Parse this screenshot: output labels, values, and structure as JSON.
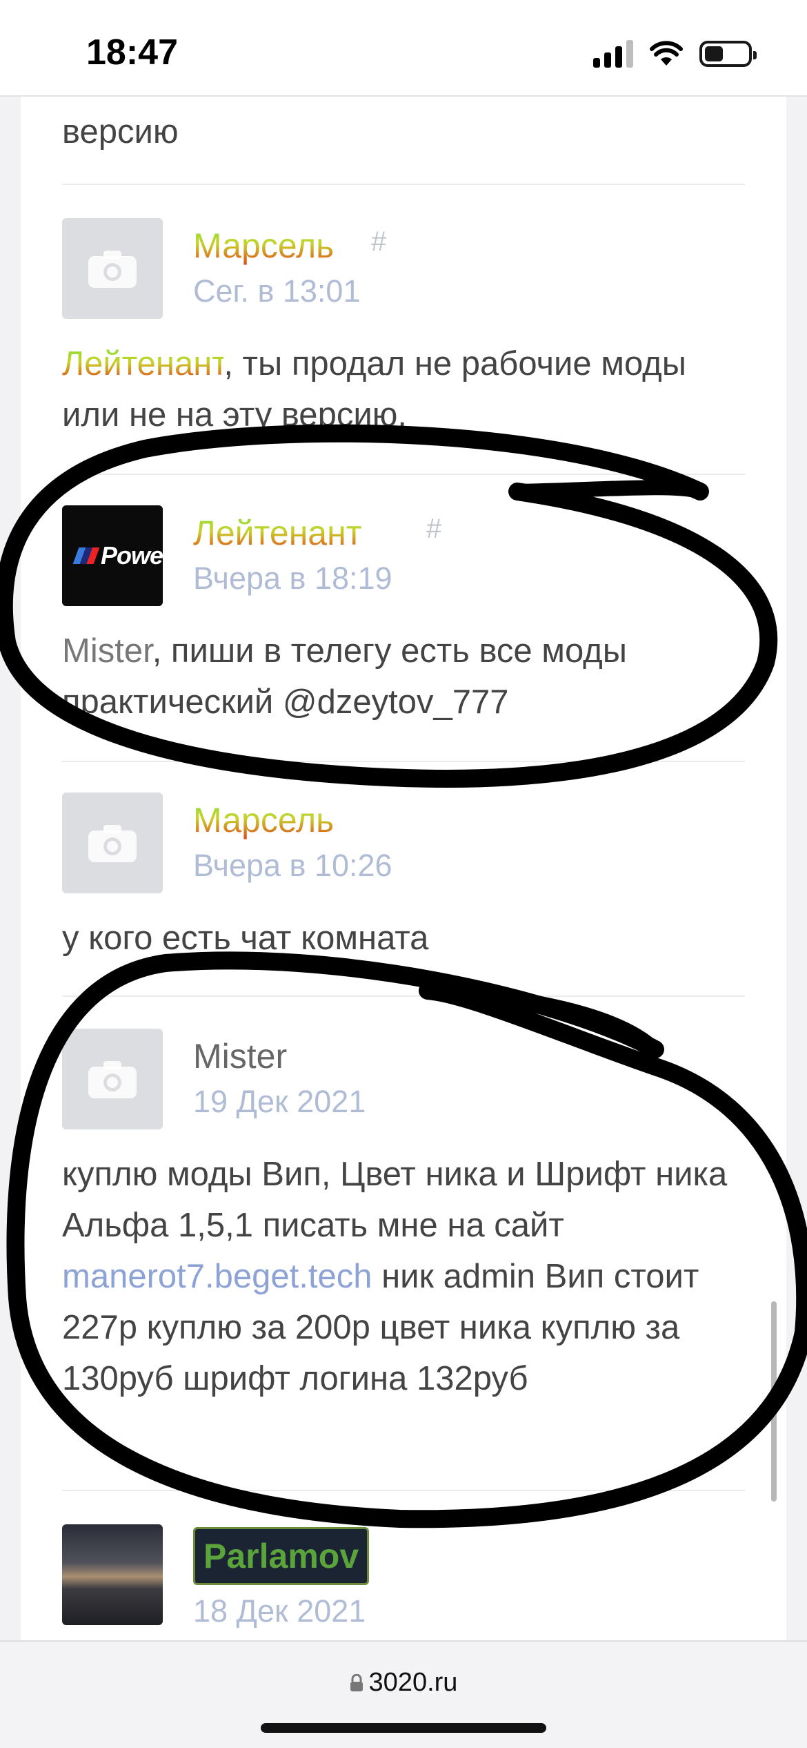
{
  "status_bar": {
    "time": "18:47"
  },
  "feed": {
    "top_fragment": "версию",
    "posts": [
      {
        "author": "Марсель",
        "hash": "#",
        "time": "Сег. в 13:01",
        "mention": "Лейтенант",
        "text": ", ты продал не рабочие моды или не на эту версию."
      },
      {
        "author": "Лейтенант",
        "hash": "#",
        "time": "Вчера в 18:19",
        "avatar_text": "Powe",
        "mention": "Mister",
        "text": ", пиши в телегу есть все моды практический @dzeytov_777"
      },
      {
        "author": "Марсель",
        "time": "Вчера в 10:26",
        "text": "у кого есть чат комната"
      },
      {
        "author": "Mister",
        "time": "19 Дек 2021",
        "text_before_link": "куплю моды Вип, Цвет ника и Шрифт ника Альфа 1,5,1 писать мне на сайт ",
        "link": "manerot7.beget.tech",
        "text_after_link": " ник admin Вип стоит 227р куплю за 200р цвет ника куплю за 130руб шрифт логина 132руб"
      },
      {
        "author": "Parlamov",
        "time": "18 Дек 2021"
      }
    ]
  },
  "browser": {
    "url": "3020.ru"
  },
  "colors": {
    "nick_gradient_top": "#7de23c",
    "nick_gradient_bottom": "#e23d1a",
    "timestamp": "#b0bcd6",
    "link": "#8da3d6"
  }
}
